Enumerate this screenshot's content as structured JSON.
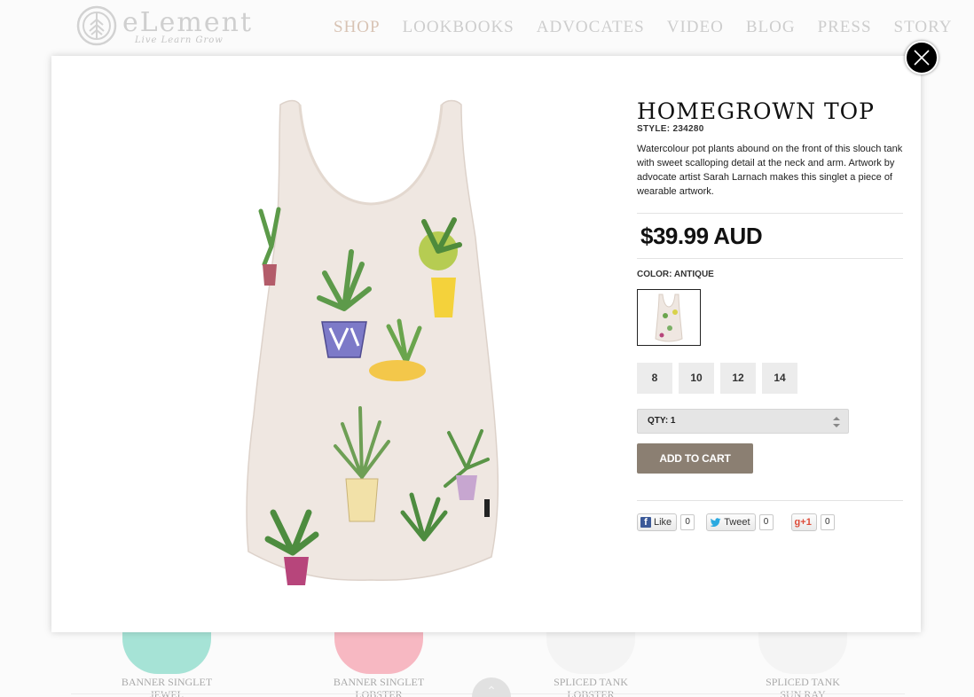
{
  "header": {
    "logo_text": "eLement",
    "logo_tagline": "Live Learn Grow",
    "nav": [
      "SHOP",
      "LOOKBOOKS",
      "ADVOCATES",
      "VIDEO",
      "BLOG",
      "PRESS",
      "STORY"
    ],
    "active_nav": "SHOP"
  },
  "modal": {
    "title": "HOMEGROWN TOP",
    "style_label": "STYLE:",
    "style_number": "234280",
    "description": "Watercolour pot plants abound on the front of this slouch tank with sweet scalloping detail at the neck and arm. Artwork by advocate artist Sarah Larnach makes this singlet a piece of wearable artwork.",
    "price": "$39.99 AUD",
    "color_label": "COLOR: ANTIQUE",
    "sizes": [
      "8",
      "10",
      "12",
      "14"
    ],
    "qty_label": "QTY: 1",
    "add_to_cart": "ADD TO CART",
    "social": {
      "fb_label": "Like",
      "fb_count": "0",
      "tw_label": "Tweet",
      "tw_count": "0",
      "gp_label": "+1",
      "gp_count": "0"
    }
  },
  "background_products": [
    {
      "name_line1": "BANNER SINGLET",
      "name_line2": "JEWEL",
      "color": "#a6e3d6"
    },
    {
      "name_line1": "BANNER SINGLET",
      "name_line2": "LOBSTER",
      "color": "#f7b8c2"
    },
    {
      "name_line1": "SPLICED TANK",
      "name_line2": "LOBSTER",
      "color": "#f6f6f6"
    },
    {
      "name_line1": "SPLICED TANK",
      "name_line2": "SUN RAY",
      "color": "#f6f6f6"
    }
  ],
  "colors": {
    "button_add_cart": "#8b7f72",
    "garment": "#efe7e1",
    "nav_inactive": "#cdcdcd",
    "nav_active": "#d8c3b4"
  }
}
